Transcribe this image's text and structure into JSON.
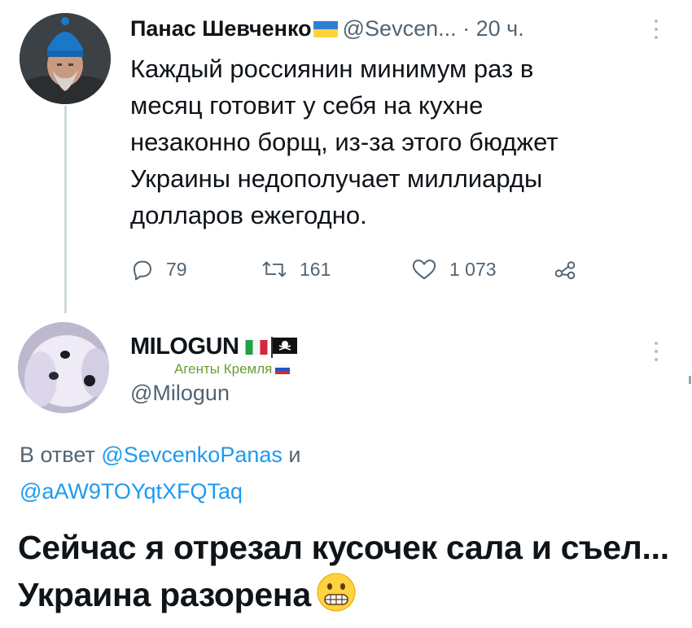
{
  "tweet": {
    "author_name": "Панас Шевченко",
    "author_handle": "@Sevcen...",
    "separator": " · ",
    "time": "20 ч.",
    "text": "Каждый россиянин минимум раз в\nмесяц готовит у себя на кухне\nнезаконно борщ, из-за этого бюджет\nУкраины недополучает миллиарды\nдолларов ежегодно.",
    "replies": "79",
    "retweets": "161",
    "likes": "1 073",
    "icons": [
      "reply-icon",
      "retweet-icon",
      "like-icon",
      "share-icon",
      "more-icon"
    ],
    "flag": "ukraine-flag"
  },
  "reply": {
    "author_name": "MILOGUN",
    "author_flags": [
      "italy-flag",
      "pirate-flag"
    ],
    "badge_text": "Агенты Кремля",
    "badge_flag": "russia-flag",
    "author_handle": "@Milogun",
    "reply_prefix": "В ответ",
    "mention_1": "@SevcenkoPanas",
    "conjunction": "и",
    "mention_2": "@aAW9TOYqtXFQTaq",
    "text": "Сейчас я отрезал кусочек сала и съел... Украина разорена",
    "emoji": "grimacing-face-emoji"
  },
  "colors": {
    "text": "#0f1419",
    "secondary": "#536471",
    "link": "#1d9bf0",
    "thread_line": "#cfd9de",
    "badge": "#6a9e2e"
  }
}
